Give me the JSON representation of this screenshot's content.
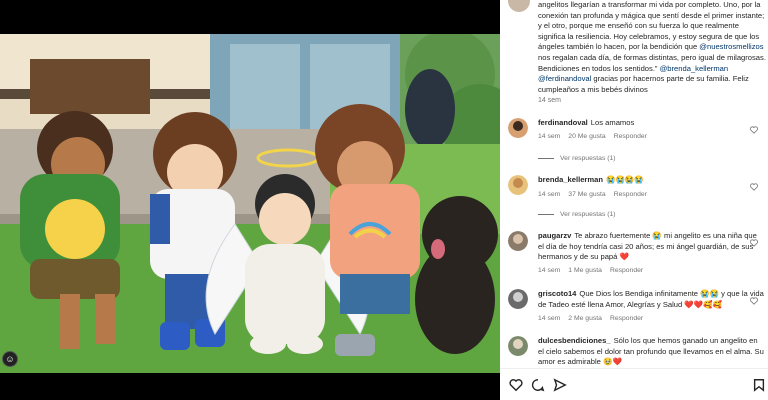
{
  "caption": {
    "text": "angelitos llegarían a transformar mi vida por completo. Uno, por la conexión tan profunda y mágica que sentí desde el primer instante; y el otro, porque me enseñó con su fuerza lo que realmente significa la resiliencia. Hoy celebramos, y estoy segura de que los ángeles también lo hacen, por la bendición que",
    "mention1": "@nuestrosmellizos",
    "text2": " nos regalan cada día, de formas distintas, pero igual de milagrosas. Bendiciones en todos los sentidos.”",
    "mention2": "@brenda_kellerman",
    "mention3": "@ferdinandoval",
    "text3": " gracias por hacernos parte de su familia. Feliz cumpleaños a mis bebés divinos",
    "time": "14 sem"
  },
  "comments": [
    {
      "user": "ferdinandoval",
      "text": "Los amamos",
      "time": "14 sem",
      "likes": "20 Me gusta",
      "reply": "Responder",
      "view_replies": "Ver respuestas (1)"
    },
    {
      "user": "brenda_kellerman",
      "text": "😭😭😭😭",
      "time": "14 sem",
      "likes": "37 Me gusta",
      "reply": "Responder",
      "view_replies": "Ver respuestas (1)"
    },
    {
      "user": "paugarzv",
      "text": "Te abrazo fuertemente 😭 mi angelito es una niña que el día de hoy tendría casi 20 años; es mi ángel guardián, de sus hermanos y de su papá ❤️",
      "time": "14 sem",
      "likes": "1 Me gusta",
      "reply": "Responder"
    },
    {
      "user": "griscoto14",
      "text": "Que Dios los Bendiga infinitamente 😭😭 y que la vida de Tadeo esté llena Amor, Alegrías y Salud ❤️❤️🥰🥰",
      "time": "14 sem",
      "likes": "2 Me gusta",
      "reply": "Responder"
    },
    {
      "user": "dulcesbendiciones_",
      "text": "Sólo los que hemos ganado un angelito en el cielo sabemos el dolor tan profundo que llevamos en el alma. Su amor es admirable 🥹❤️",
      "time": "",
      "likes": "",
      "reply": ""
    }
  ],
  "icons": [
    "heart-icon",
    "comment-icon",
    "share-icon",
    "bookmark-icon",
    "user-tag-icon"
  ]
}
